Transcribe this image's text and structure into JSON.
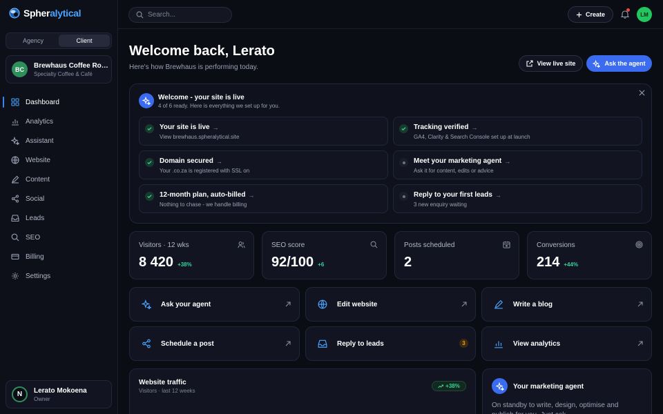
{
  "brand": {
    "name_main": "Spher",
    "name_accent": "alytical",
    "accent": "#4aa3ff"
  },
  "colors": {
    "primary": "#3b6cf0",
    "success": "#34d399",
    "background": "#0b0d14"
  },
  "sidebar": {
    "segment": {
      "agency": "Agency",
      "client": "Client",
      "selected": "Client"
    },
    "business": {
      "initials": "BC",
      "name": "Brewhaus Coffee Roasters",
      "sub": "Specialty Coffee & Café"
    },
    "nav": [
      {
        "label": "Dashboard",
        "icon": "grid-icon"
      },
      {
        "label": "Analytics",
        "icon": "bar-chart-icon"
      },
      {
        "label": "Assistant",
        "icon": "sparkles-icon"
      },
      {
        "label": "Website",
        "icon": "globe-icon"
      },
      {
        "label": "Content",
        "icon": "pen-icon"
      },
      {
        "label": "Social",
        "icon": "share-icon"
      },
      {
        "label": "Leads",
        "icon": "inbox-icon"
      },
      {
        "label": "SEO",
        "icon": "search-icon"
      },
      {
        "label": "Billing",
        "icon": "card-icon"
      },
      {
        "label": "Settings",
        "icon": "gear-icon"
      }
    ],
    "user": {
      "initial": "N",
      "name": "Lerato Mokoena",
      "role": "Owner"
    }
  },
  "topbar": {
    "search_placeholder": "Search...",
    "create_label": "Create",
    "avatar_initials": "LM"
  },
  "header": {
    "title": "Welcome back, Lerato",
    "subtitle": "Here's how Brewhaus is performing today.",
    "view_live_label": "View live site",
    "ask_agent_label": "Ask the agent"
  },
  "onboarding": {
    "title": "Welcome - your site is live",
    "subtitle": "4 of 6 ready. Here is everything we set up for you.",
    "tasks": [
      {
        "title": "Your site is live",
        "sub": "View brewhaus.spheralytical.site",
        "done": true
      },
      {
        "title": "Tracking verified",
        "sub": "GA4, Clarity & Search Console set up at launch",
        "done": true
      },
      {
        "title": "Domain secured",
        "sub": "Your .co.za is registered with SSL on",
        "done": true
      },
      {
        "title": "Meet your marketing agent",
        "sub": "Ask it for content, edits or advice",
        "done": false
      },
      {
        "title": "12-month plan, auto-billed",
        "sub": "Nothing to chase - we handle billing",
        "done": true
      },
      {
        "title": "Reply to your first leads",
        "sub": "3 new enquiry waiting",
        "done": false
      }
    ]
  },
  "stats": [
    {
      "label": "Visitors · 12 wks",
      "value": "8 420",
      "delta": "+38%",
      "icon": "users-icon"
    },
    {
      "label": "SEO score",
      "value": "92/100",
      "delta": "+6",
      "icon": "search-icon"
    },
    {
      "label": "Posts scheduled",
      "value": "2",
      "delta": "",
      "icon": "calendar-icon"
    },
    {
      "label": "Conversions",
      "value": "214",
      "delta": "+44%",
      "icon": "target-icon"
    }
  ],
  "actions": [
    {
      "label": "Ask your agent",
      "icon": "sparkles-icon"
    },
    {
      "label": "Edit website",
      "icon": "globe-icon"
    },
    {
      "label": "Write a blog",
      "icon": "pen-icon"
    },
    {
      "label": "Schedule a post",
      "icon": "share-icon"
    },
    {
      "label": "Reply to leads",
      "icon": "inbox-icon",
      "badge": "3"
    },
    {
      "label": "View analytics",
      "icon": "bar-chart-icon"
    }
  ],
  "traffic": {
    "title": "Website traffic",
    "sub": "Visitors · last 12 weeks",
    "delta": "+38%"
  },
  "agent_card": {
    "title": "Your marketing agent",
    "sub": "On standby to write, design, optimise and publish for you. Just ask."
  }
}
